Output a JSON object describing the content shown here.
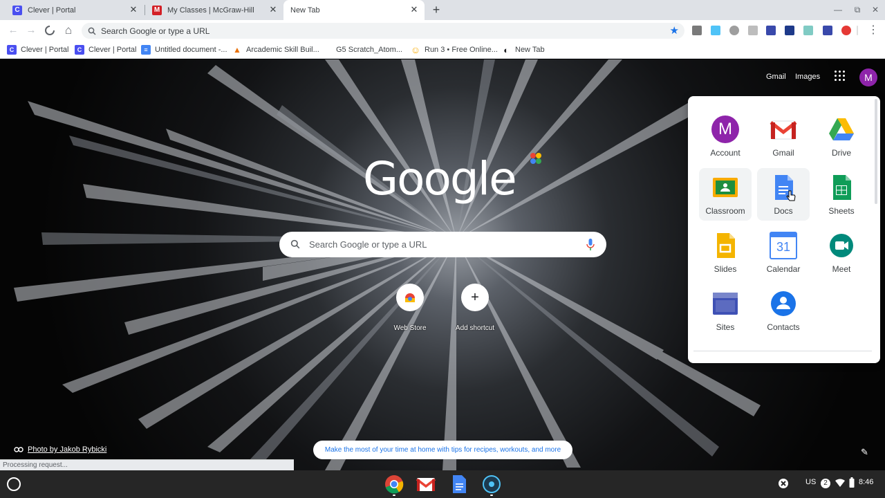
{
  "tabs": [
    {
      "title": "Clever | Portal",
      "icon": "clever-icon",
      "fav": "C",
      "color": "#4a4ff0"
    },
    {
      "title": "My Classes | McGraw-Hill",
      "icon": "mcgraw-hill-icon",
      "fav": "M",
      "color": "#d31f26"
    },
    {
      "title": "New Tab",
      "icon": "",
      "fav": "",
      "color": ""
    }
  ],
  "tab_close": "✕",
  "new_tab": "+",
  "window": {
    "minimize": "—",
    "restore": "⧉",
    "close": "✕"
  },
  "toolbar": {
    "back": "←",
    "forward": "→",
    "reload": "✕",
    "home": "⌂",
    "omnibox_placeholder": "Search Google or type a URL",
    "star": "★",
    "menu": "⋮"
  },
  "bookmarks": [
    {
      "label": "Clever | Portal",
      "fav": "C",
      "color": "#4a4ff0"
    },
    {
      "label": "Clever | Portal",
      "fav": "C",
      "color": "#4a4ff0"
    },
    {
      "label": "Untitled document -...",
      "fav": "≡",
      "color": "#4285f4"
    },
    {
      "label": "Arcademic Skill Buil...",
      "fav": "▲",
      "color": "#e8710a"
    },
    {
      "label": "G5 Scratch_Atom...",
      "fav": "",
      "color": ""
    },
    {
      "label": "Run 3 • Free Online...",
      "fav": "☺",
      "color": "#f9ab00"
    },
    {
      "label": "New Tab",
      "fav": "◐",
      "color": "#202124"
    }
  ],
  "ntp": {
    "gmail_link": "Gmail",
    "images_link": "Images",
    "avatar_letter": "M",
    "logo": "Google",
    "search_placeholder": "Search Google or type a URL",
    "shortcuts": [
      {
        "label": "Web Store",
        "glyph": ""
      },
      {
        "label": "Add shortcut",
        "glyph": "+"
      }
    ],
    "photo_credit": "Photo by Jakob Rybicki",
    "promo": "Make the most of your time at home with tips for recipes, workouts, and more",
    "edit": "✎"
  },
  "apps_menu": {
    "items": [
      {
        "label": "Account",
        "icon": "account-icon"
      },
      {
        "label": "Gmail",
        "icon": "gmail-icon"
      },
      {
        "label": "Drive",
        "icon": "drive-icon"
      },
      {
        "label": "Classroom",
        "icon": "classroom-icon"
      },
      {
        "label": "Docs",
        "icon": "docs-icon"
      },
      {
        "label": "Sheets",
        "icon": "sheets-icon"
      },
      {
        "label": "Slides",
        "icon": "slides-icon"
      },
      {
        "label": "Calendar",
        "icon": "calendar-icon"
      },
      {
        "label": "Meet",
        "icon": "meet-icon"
      },
      {
        "label": "Sites",
        "icon": "sites-icon"
      },
      {
        "label": "Contacts",
        "icon": "contacts-icon"
      }
    ],
    "account_letter": "M",
    "calendar_day": "31"
  },
  "status_text": "Processing request...",
  "tray": {
    "locale": "US",
    "notifications": "2",
    "time": "8:46"
  },
  "colors": {
    "accent": "#1a73e8",
    "avatar": "#8e24aa",
    "tabstrip": "#dee1e6"
  }
}
